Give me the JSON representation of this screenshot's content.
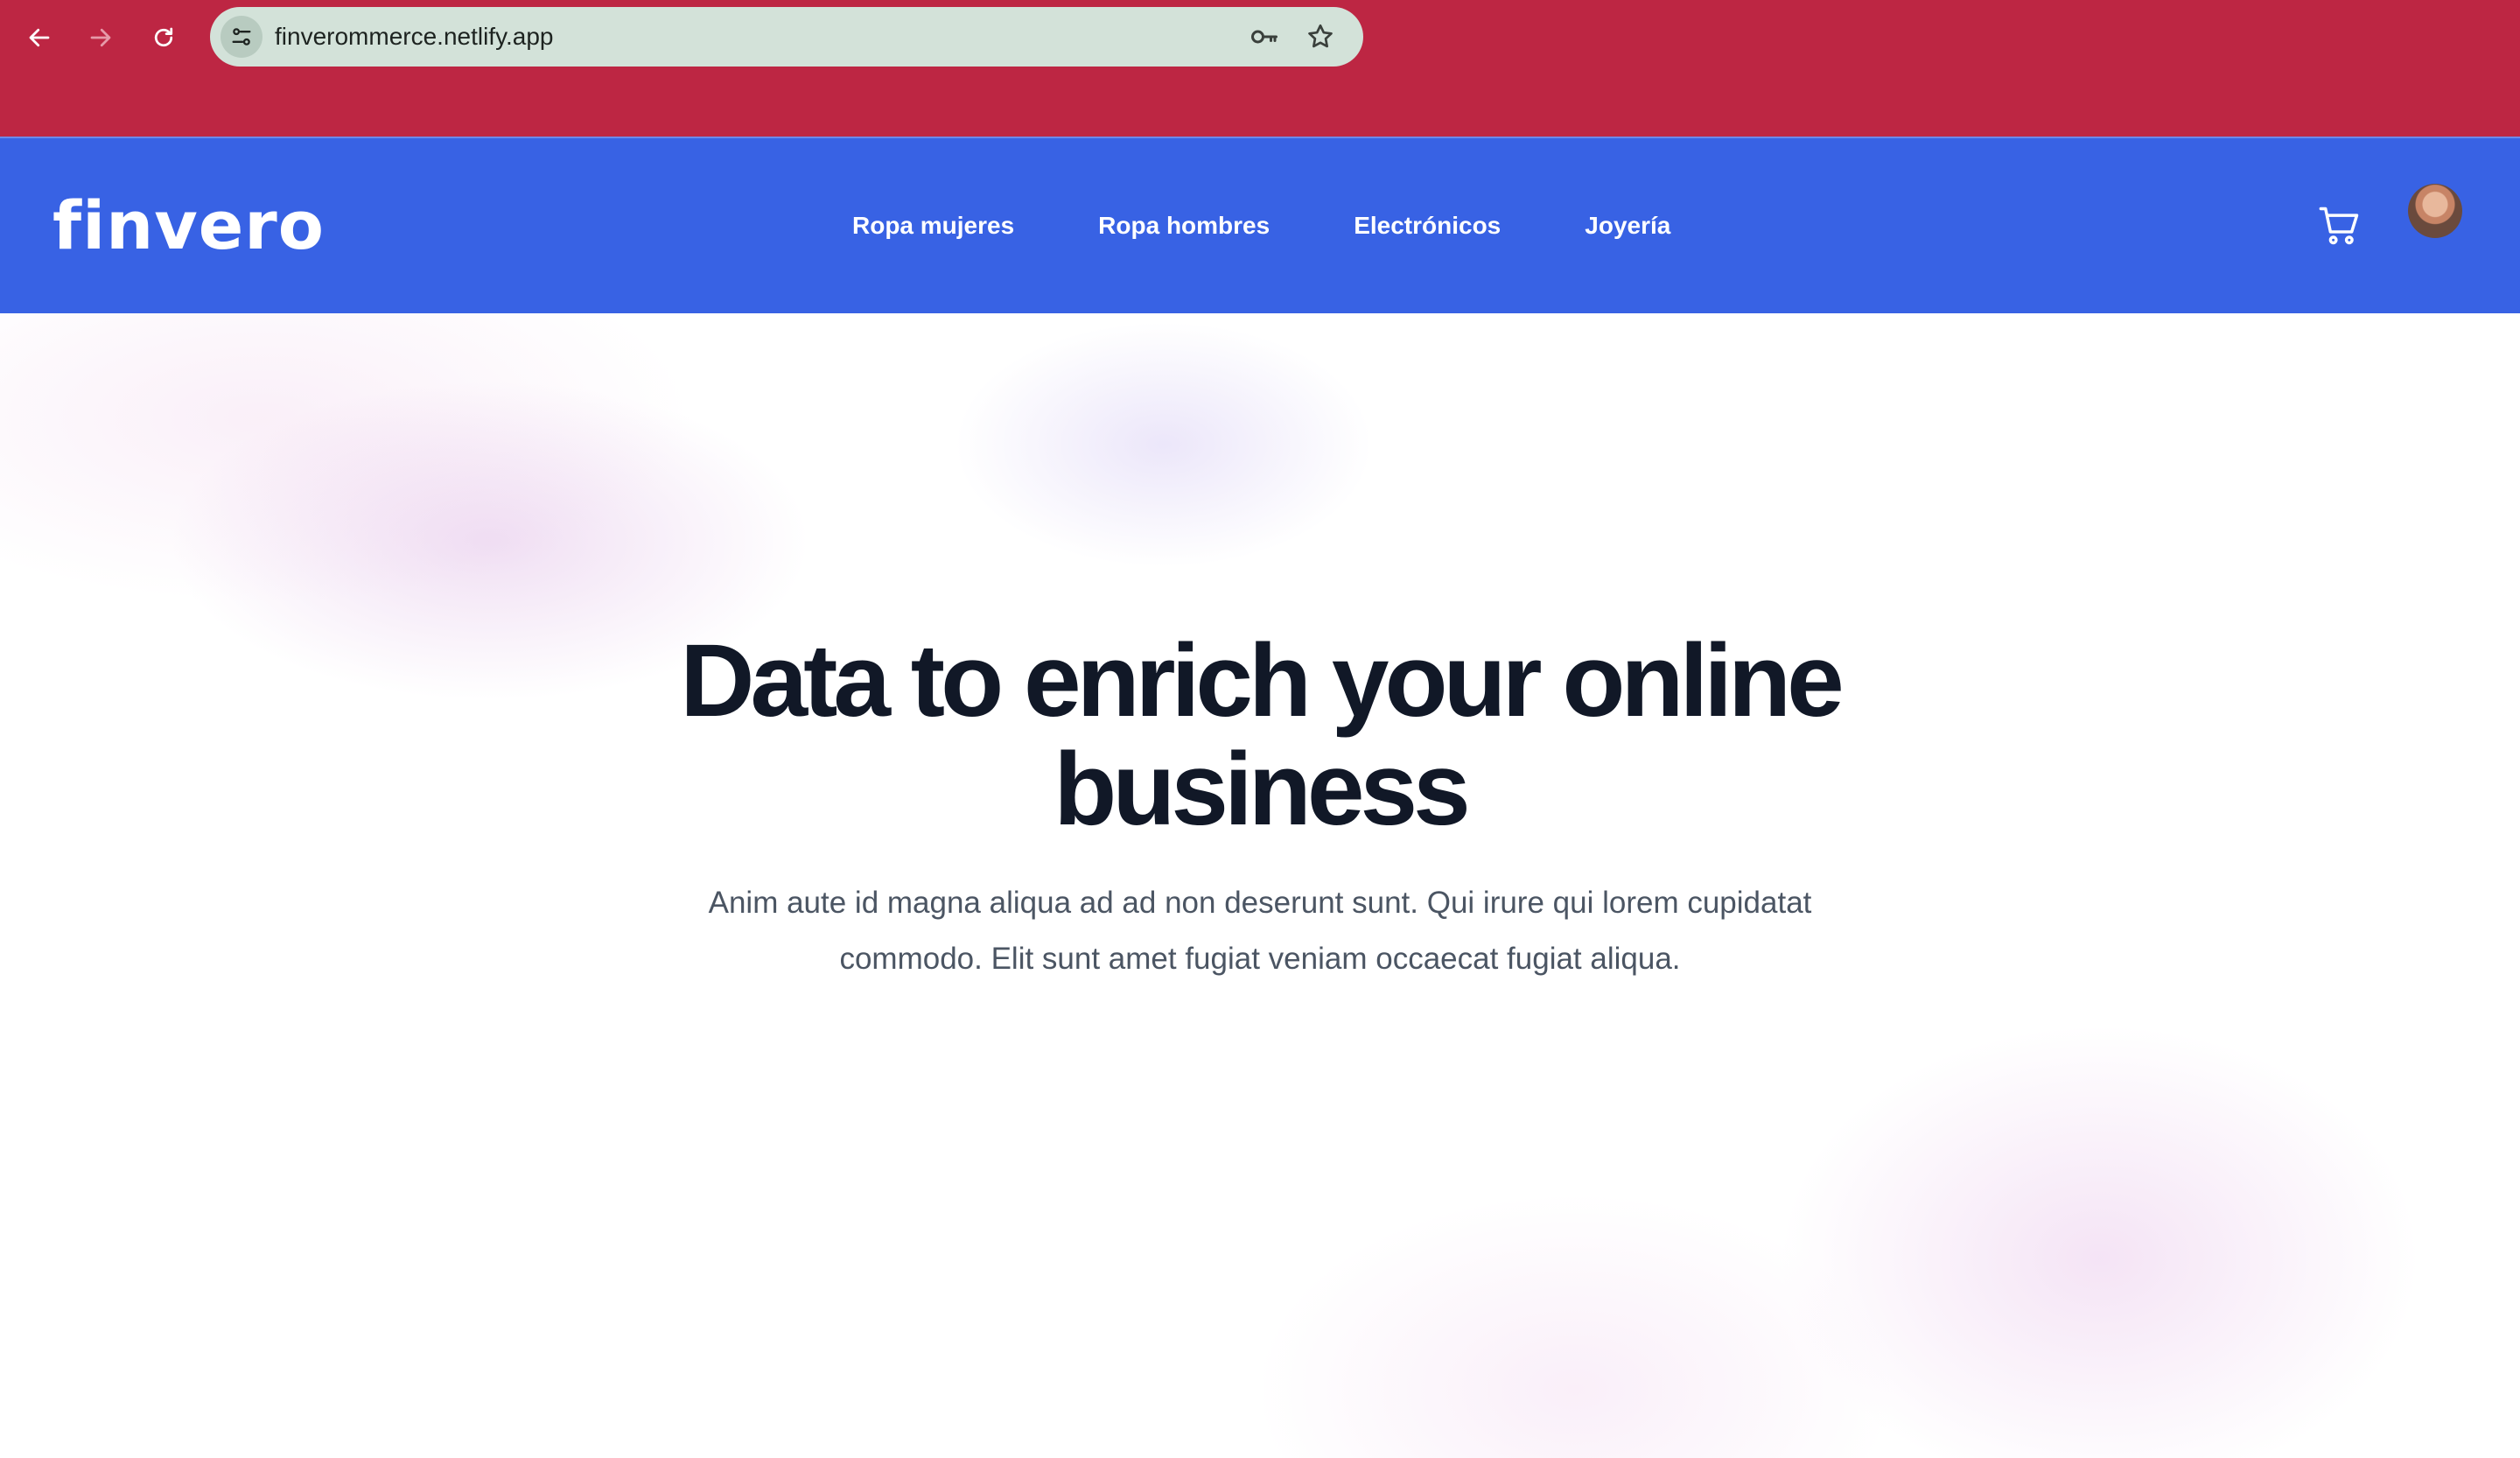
{
  "browser": {
    "url": "finverommerce.netlify.app",
    "icons": [
      "back-arrow-icon",
      "forward-arrow-icon",
      "reload-icon",
      "site-info-icon",
      "key-icon",
      "star-icon"
    ]
  },
  "header": {
    "logo": "finvero",
    "nav": [
      {
        "label": "Ropa mujeres"
      },
      {
        "label": "Ropa hombres"
      },
      {
        "label": "Electrónicos"
      },
      {
        "label": "Joyería"
      }
    ],
    "icons": [
      "cart-icon",
      "avatar"
    ]
  },
  "hero": {
    "title_line1": "Data to enrich your online",
    "title_line2": "business",
    "subtitle_line1": "Anim aute id magna aliqua ad ad non deserunt sunt. Qui irure qui lorem cupidatat",
    "subtitle_line2": "commodo. Elit sunt amet fugiat veniam occaecat fugiat aliqua."
  },
  "colors": {
    "browser_chrome": "#bd2643",
    "header": "#3862e4",
    "title": "#111827",
    "subtitle": "#4b5563"
  }
}
